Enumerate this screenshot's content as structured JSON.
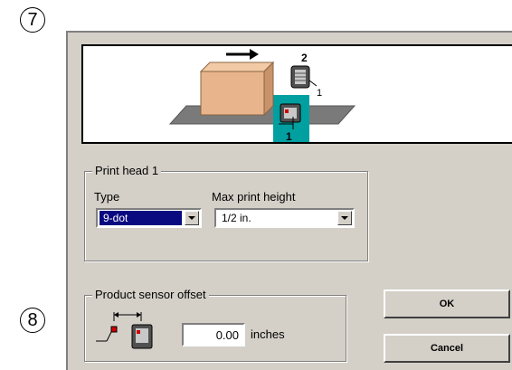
{
  "callouts": {
    "top": "7",
    "bottom": "8"
  },
  "diagram": {
    "upper_head_label": "2",
    "head_sub_label": "1",
    "lower_head_label": "1",
    "highlight_color": "#00a0a0",
    "box_color": "#e8b48c",
    "belt_color": "#7a7a7a"
  },
  "print_head": {
    "group_title": "Print head 1",
    "type_label": "Type",
    "type_value": "9-dot",
    "height_label": "Max print height",
    "height_value": "1/2 in."
  },
  "sensor": {
    "group_title": "Product sensor offset",
    "value": "0.00",
    "unit": "inches"
  },
  "buttons": {
    "ok": "OK",
    "cancel": "Cancel"
  },
  "colors": {
    "dialog_bg": "#d4d0c8",
    "selection_bg": "#0a0a80"
  }
}
